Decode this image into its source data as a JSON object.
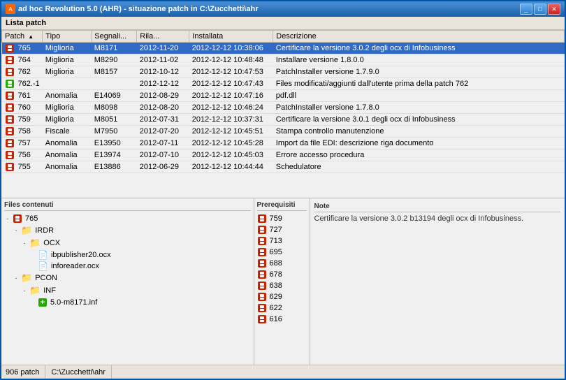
{
  "window": {
    "title": "ad hoc Revolution 5.0 (AHR) - situazione patch in C:\\Zucchetti\\ahr",
    "toolbar_label": "Lista patch"
  },
  "table": {
    "columns": [
      "Patch",
      "Tipo",
      "Segnali...",
      "Rila...",
      "Installata",
      "Descrizione"
    ],
    "rows": [
      {
        "id": "765",
        "patch": "765",
        "tipo": "Miglioria",
        "segnali": "M8171",
        "rilascio": "2012-11-20",
        "installata": "2012-12-12 10:38:06",
        "descrizione": "Certificare la versione 3.0.2 degli ocx di Infobusiness",
        "selected": true,
        "icon": "red"
      },
      {
        "id": "764",
        "patch": "764",
        "tipo": "Miglioria",
        "segnali": "M8290",
        "rilascio": "2012-11-02",
        "installata": "2012-12-12 10:48:48",
        "descrizione": "Installare versione 1.8.0.0",
        "selected": false,
        "icon": "red"
      },
      {
        "id": "762",
        "patch": "762",
        "tipo": "Miglioria",
        "segnali": "M8157",
        "rilascio": "2012-10-12",
        "installata": "2012-12-12 10:47:53",
        "descrizione": "PatchInstaller versione 1.7.9.0",
        "selected": false,
        "icon": "red"
      },
      {
        "id": "762-1",
        "patch": "762.-1",
        "tipo": "",
        "segnali": "",
        "rilascio": "2012-12-12",
        "installata": "2012-12-12 10:47:43",
        "descrizione": "Files modificati/aggiunti dall'utente prima della patch 762",
        "selected": false,
        "icon": "green"
      },
      {
        "id": "761",
        "patch": "761",
        "tipo": "Anomalia",
        "segnali": "E14069",
        "rilascio": "2012-08-29",
        "installata": "2012-12-12 10:47:16",
        "descrizione": "pdf.dll",
        "selected": false,
        "icon": "red"
      },
      {
        "id": "760",
        "patch": "760",
        "tipo": "Miglioria",
        "segnali": "M8098",
        "rilascio": "2012-08-20",
        "installata": "2012-12-12 10:46:24",
        "descrizione": "PatchInstaller versione 1.7.8.0",
        "selected": false,
        "icon": "red"
      },
      {
        "id": "759",
        "patch": "759",
        "tipo": "Miglioria",
        "segnali": "M8051",
        "rilascio": "2012-07-31",
        "installata": "2012-12-12 10:37:31",
        "descrizione": "Certificare la versione 3.0.1 degli ocx di Infobusiness",
        "selected": false,
        "icon": "red"
      },
      {
        "id": "758",
        "patch": "758",
        "tipo": "Fiscale",
        "segnali": "M7950",
        "rilascio": "2012-07-20",
        "installata": "2012-12-12 10:45:51",
        "descrizione": "Stampa controllo manutenzione",
        "selected": false,
        "icon": "red"
      },
      {
        "id": "757",
        "patch": "757",
        "tipo": "Anomalia",
        "segnali": "E13950",
        "rilascio": "2012-07-11",
        "installata": "2012-12-12 10:45:28",
        "descrizione": "Import da file EDI: descrizione riga documento",
        "selected": false,
        "icon": "red"
      },
      {
        "id": "756",
        "patch": "756",
        "tipo": "Anomalia",
        "segnali": "E13974",
        "rilascio": "2012-07-10",
        "installata": "2012-12-12 10:45:03",
        "descrizione": "Errore accesso procedura",
        "selected": false,
        "icon": "red"
      },
      {
        "id": "755",
        "patch": "755",
        "tipo": "Anomalia",
        "segnali": "E13886",
        "rilascio": "2012-06-29",
        "installata": "2012-12-12 10:44:44",
        "descrizione": "Schedulatore",
        "selected": false,
        "icon": "red"
      }
    ]
  },
  "files_panel": {
    "label": "Files contenuti",
    "tree": [
      {
        "level": 0,
        "type": "root",
        "label": "765",
        "icon": "red-box",
        "expand": "-"
      },
      {
        "level": 1,
        "type": "folder",
        "label": "IRDR",
        "icon": "folder",
        "expand": "-"
      },
      {
        "level": 2,
        "type": "folder",
        "label": "OCX",
        "icon": "folder",
        "expand": "-"
      },
      {
        "level": 3,
        "type": "file",
        "label": "ibpublisher20.ocx",
        "icon": "file"
      },
      {
        "level": 3,
        "type": "file",
        "label": "inforeader.ocx",
        "icon": "file"
      },
      {
        "level": 1,
        "type": "folder",
        "label": "PCON",
        "icon": "folder",
        "expand": "-"
      },
      {
        "level": 2,
        "type": "folder",
        "label": "INF",
        "icon": "folder",
        "expand": "-"
      },
      {
        "level": 3,
        "type": "file",
        "label": "5.0-m8171.inf",
        "icon": "inf-file"
      }
    ]
  },
  "prereq_panel": {
    "label": "Prerequisiti",
    "items": [
      "759",
      "727",
      "713",
      "695",
      "688",
      "678",
      "638",
      "629",
      "622",
      "616"
    ]
  },
  "note_panel": {
    "label": "Note",
    "text": "Certificare la versione 3.0.2 b13194 degli ocx di Infobusiness."
  },
  "status_bar": {
    "count": "906 patch",
    "path": "C:\\Zucchetti\\ahr"
  }
}
